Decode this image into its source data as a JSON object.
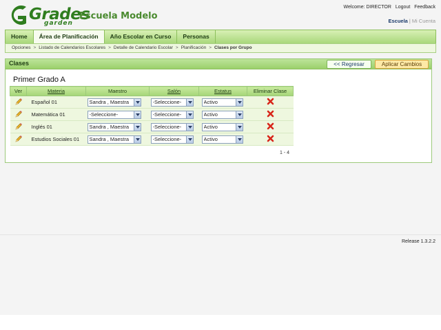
{
  "header": {
    "logo_text": "Grades",
    "logo_sub": "garden",
    "school_name": "Escuela Modelo",
    "welcome": "Welcome: DIRECTOR",
    "logout": "Logout",
    "feedback": "Feedback",
    "account_active": "Escuela",
    "account_inactive": "Mi Cuenta",
    "brand_color": "#2f7d1f"
  },
  "nav": {
    "tabs": [
      {
        "label": "Home"
      },
      {
        "label": "Área de Planificación"
      },
      {
        "label": "Año Escolar en Curso"
      },
      {
        "label": "Personas"
      }
    ],
    "active_index": 1
  },
  "breadcrumb": {
    "items": [
      "Opciones",
      "Listado de Calendarios Escolares",
      "Detalle de Calendario Escolar",
      "Planificación"
    ],
    "current": "Clases por Grupo"
  },
  "panel": {
    "title": "Clases",
    "back_label": "<< Regresar",
    "apply_label": "Aplicar Cambios",
    "section_title": "Primer Grado A"
  },
  "table": {
    "headers": {
      "ver": "Ver",
      "materia": "Materia",
      "maestro": "Maestro",
      "salon": "Salón",
      "estatus": "Estatus",
      "eliminar": "Eliminar Clase"
    },
    "rows": [
      {
        "materia": "Español 01",
        "maestro": "Sandra , Maestra",
        "salon": "-Seleccione-",
        "estatus": "Activo"
      },
      {
        "materia": "Matemática 01",
        "maestro": "-Seleccione-",
        "salon": "-Seleccione-",
        "estatus": "Activo"
      },
      {
        "materia": "Inglés 01",
        "maestro": "Sandra , Maestra",
        "salon": "-Seleccione-",
        "estatus": "Activo"
      },
      {
        "materia": "Estudios Sociales 01",
        "maestro": "Sandra , Maestra",
        "salon": "-Seleccione-",
        "estatus": "Activo"
      }
    ],
    "pager": "1 - 4"
  },
  "footer": {
    "release": "Release 1.3.2.2"
  },
  "icons": {
    "edit": "pencil-icon",
    "delete": "red-x-icon"
  }
}
